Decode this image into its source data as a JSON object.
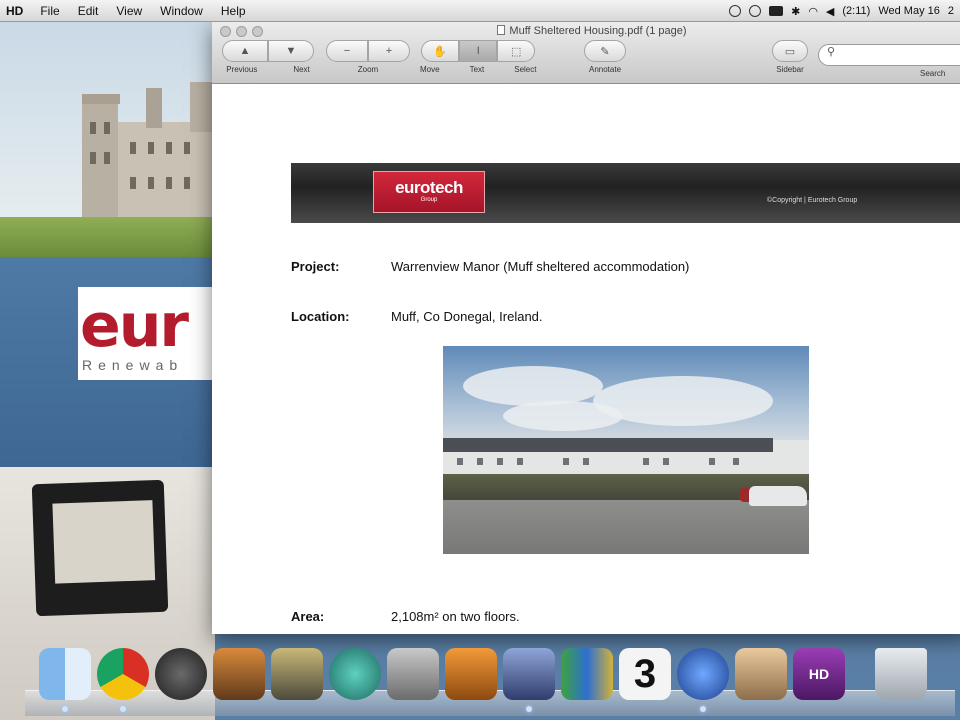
{
  "menubar": {
    "app": "HD",
    "items": [
      "File",
      "Edit",
      "View",
      "Window",
      "Help"
    ],
    "clock": "Wed May 16",
    "clock_extra": "2",
    "battery": "(2:11)"
  },
  "window": {
    "title": "Muff Sheltered Housing.pdf (1 page)",
    "toolbar": {
      "previous": "Previous",
      "next": "Next",
      "zoom": "Zoom",
      "move": "Move",
      "text": "Text",
      "select": "Select",
      "annotate": "Annotate",
      "sidebar": "Sidebar",
      "search": "Search"
    },
    "search_placeholder": ""
  },
  "document": {
    "banner_logo": "eurotech",
    "banner_logo_sub": "Group",
    "banner_copyright": "©Copyright | Eurotech Group",
    "fields": [
      {
        "label": "Project:",
        "value": "Warrenview Manor (Muff sheltered accommodation)"
      },
      {
        "label": "Location:",
        "value": "Muff, Co Donegal, Ireland."
      },
      {
        "label": "Area:",
        "value": "2,108m² on two floors."
      }
    ]
  },
  "desktop": {
    "logo_big": "eur",
    "logo_small": "Renewab"
  },
  "dock": {
    "icons": [
      "finder-icon",
      "chrome-icon",
      "dashboard-icon",
      "iphoto-icon",
      "imovie-icon",
      "time-machine-icon",
      "system-preferences-icon",
      "presentation-icon",
      "quill-icon",
      "numbers-icon",
      "three-mobile-icon",
      "messenger-icon",
      "photo-booth-icon",
      "hd-video-icon",
      "trash-icon"
    ]
  },
  "colors": {
    "brand_red": "#b31c2c",
    "banner_dark": "#2a2a2a"
  }
}
